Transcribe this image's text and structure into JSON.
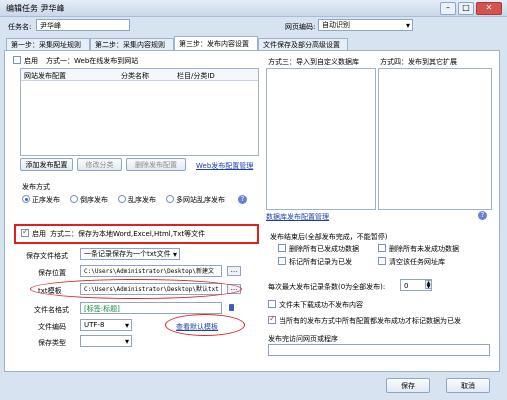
{
  "window": {
    "title": "编辑任务 尹华峰"
  },
  "header": {
    "task_name_label": "任务名:",
    "task_name_value": "尹华峰",
    "encoding_label": "网页编码:",
    "encoding_value": "自动识别"
  },
  "tabs": [
    {
      "label": "第一步：采集网址规则"
    },
    {
      "label": "第二步：采集内容规则"
    },
    {
      "label": "第三步：发布内容设置"
    },
    {
      "label": "文件保存及部分高级设置"
    }
  ],
  "method1": {
    "enable_label": "启用",
    "desc": "方式一：Web在线发布到网站",
    "columns": [
      "网站发布配置",
      "分类名称",
      "栏目/分类ID"
    ],
    "add_button": "添加发布配置",
    "edit_button": "修改分类",
    "delete_button": "删除发布配置",
    "manage_link": "Web发布配置管理",
    "publish_mode_label": "发布方式",
    "modes": [
      "正序发布",
      "倒序发布",
      "乱序发布",
      "多网站乱序发布"
    ],
    "selected_mode": "正序发布"
  },
  "method3": {
    "title": "方式三：导入到自定义数据库",
    "manage_link": "数据库发布配置管理"
  },
  "method4": {
    "title": "方式四：发布到其它扩展"
  },
  "method2": {
    "enable_label": "启用",
    "desc": "方式二：保存为本地Word,Excel,Html,Txt等文件",
    "format_label": "保存文件格式",
    "format_value": "一条记录保存为一个txt文件",
    "location_label": "保存位置",
    "location_value": "C:\\Users\\Administrator\\Desktop\\新建文",
    "template_label": "txt模板",
    "template_value": "C:\\Users\\Administrator\\Desktop\\默认txt",
    "browse_label": "...",
    "filename_label": "文件名格式",
    "filename_value": "[标签:标题]",
    "view_template_link": "查看默认模板",
    "encoding_label": "文件编码",
    "encoding_value": "UTF-8",
    "save_type_label": "保存类型",
    "save_type_value": ""
  },
  "after_publish": {
    "title": "发布结束后(全部发布完成，不能暂停)",
    "options": [
      {
        "label": "删除所有已发成功数据",
        "checked": false
      },
      {
        "label": "删除所有未发成功数据",
        "checked": false
      },
      {
        "label": "标记所有记录为已发",
        "checked": false
      },
      {
        "label": "清空该任务网址库",
        "checked": false
      }
    ]
  },
  "max_publish": {
    "label": "每次最大发布记录条数(0为全部发布):",
    "value": "0"
  },
  "skip_file_label": "文件未下载成功不发布内容",
  "mark_published_label": "当所有的发布方式中所有配置都发布成功才标记数据为已发",
  "interval_label": "发布完访问网页或程序",
  "footer": {
    "save": "保存",
    "cancel": "取消"
  },
  "annotation_colors": {
    "highlight": "#e02020"
  }
}
